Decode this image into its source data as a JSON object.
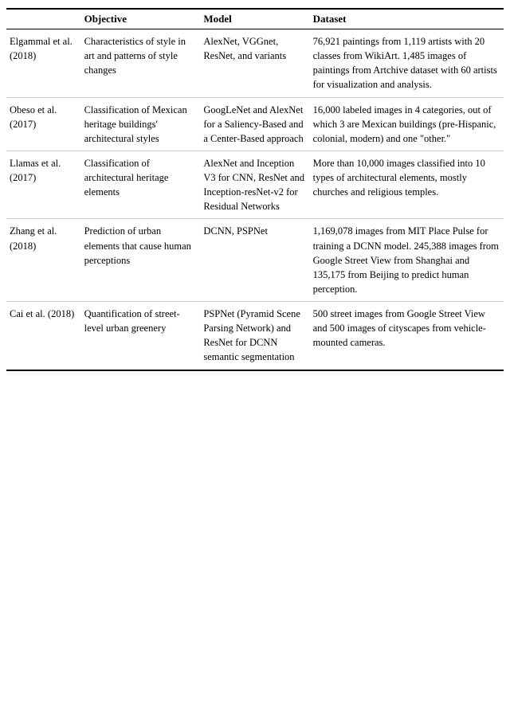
{
  "table": {
    "headers": [
      "",
      "Objective",
      "Model",
      "Dataset"
    ],
    "rows": [
      {
        "author": "Elgammal et al. (2018)",
        "objective": "Characteristics of style in art and patterns of style changes",
        "model": "AlexNet, VGGnet, ResNet, and variants",
        "dataset": "76,921 paintings from 1,119 artists with 20 classes from WikiArt. 1,485 images of paintings from Artchive dataset with 60 artists for visualization and analysis."
      },
      {
        "author": "Obeso et al. (2017)",
        "objective": "Classification of Mexican heritage buildings' architectural styles",
        "model": "GoogLeNet and AlexNet for a Saliency-Based and a Center-Based approach",
        "dataset": "16,000 labeled images in 4 categories, out of which 3 are Mexican buildings (pre-Hispanic, colonial, modern) and one \"other.\""
      },
      {
        "author": "Llamas et al. (2017)",
        "objective": "Classification of architectural heritage elements",
        "model": "AlexNet and Inception V3 for CNN, ResNet and Inception-resNet-v2 for Residual Networks",
        "dataset": "More than 10,000 images classified into 10 types of architectural elements, mostly churches and religious temples."
      },
      {
        "author": "Zhang et al. (2018)",
        "objective": "Prediction of urban elements that cause human perceptions",
        "model": "DCNN, PSPNet",
        "dataset": "1,169,078 images from MIT Place Pulse for training a DCNN model. 245,388 images from Google Street View from Shanghai and 135,175 from Beijing to predict human perception."
      },
      {
        "author": "Cai et al. (2018)",
        "objective": "Quantification of street-level urban greenery",
        "model": "PSPNet (Pyramid Scene Parsing Network) and ResNet for DCNN semantic segmentation",
        "dataset": "500 street images from Google Street View and 500 images of cityscapes from vehicle-mounted cameras."
      }
    ]
  }
}
